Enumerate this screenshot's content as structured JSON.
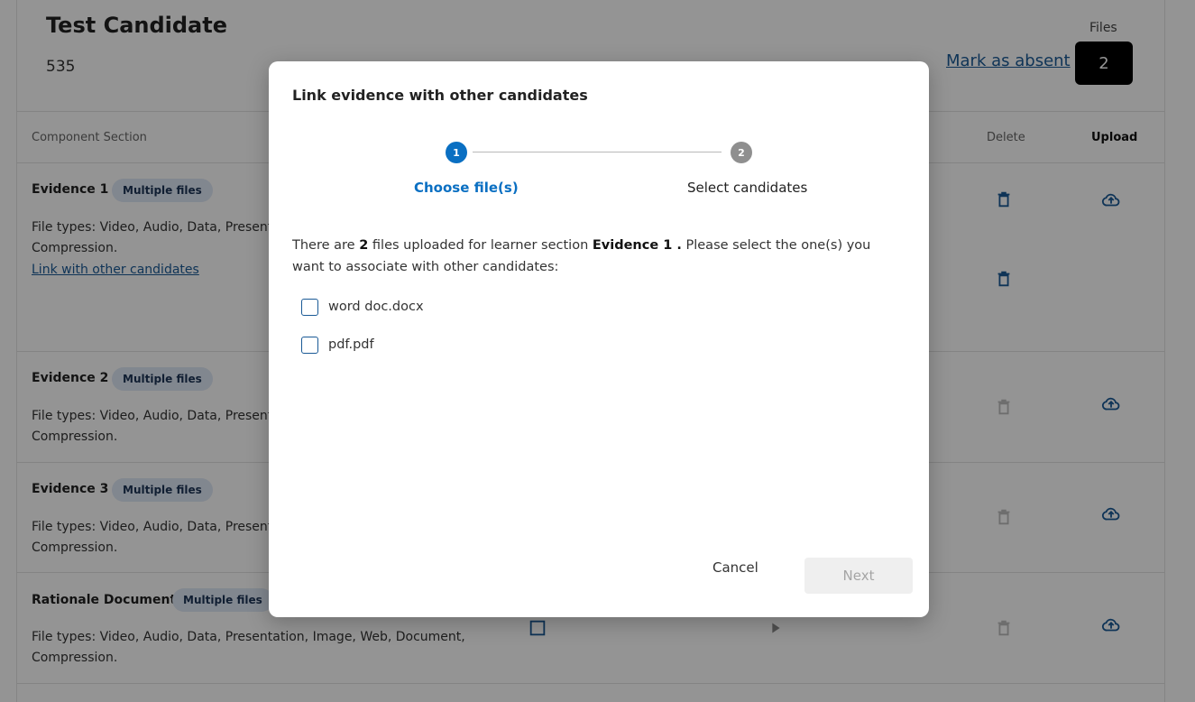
{
  "candidate": {
    "name": "Test Candidate",
    "number": "535",
    "mark_absent": "Mark as absent",
    "files_label": "Files",
    "files_count": "2"
  },
  "table": {
    "headers": {
      "section": "Component Section",
      "delete": "Delete",
      "upload": "Upload"
    },
    "rows": [
      {
        "title": "Evidence 1",
        "badge": "Multiple files",
        "filetypes_line1": "File types: Video, Audio, Data, Presenta",
        "filetypes_line2": "Compression.",
        "link": "Link with other candidates"
      },
      {
        "title": "Evidence 2",
        "badge": "Multiple files",
        "filetypes_line1": "File types: Video, Audio, Data, Presenta",
        "filetypes_line2": "Compression."
      },
      {
        "title": "Evidence 3",
        "badge": "Multiple files",
        "filetypes_line1": "File types: Video, Audio, Data, Presenta",
        "filetypes_line2": "Compression."
      },
      {
        "title": "Rationale Document",
        "badge": "Multiple files",
        "filetypes_line1": "File types: Video, Audio, Data, Presentation, Image, Web, Document,",
        "filetypes_line2": "Compression."
      }
    ]
  },
  "modal": {
    "title": "Link evidence with other candidates",
    "steps": [
      {
        "number": "1",
        "label": "Choose file(s)"
      },
      {
        "number": "2",
        "label": "Select candidates"
      }
    ],
    "description": {
      "pre": "There are ",
      "count": "2",
      "mid": " files uploaded for learner section ",
      "section": "Evidence 1 .",
      "post": " Please select the one(s) you want to associate with other candidates:"
    },
    "files": [
      "word doc.docx",
      "pdf.pdf"
    ],
    "cancel_label": "Cancel",
    "next_label": "Next"
  },
  "colors": {
    "accent": "#0a6fc2",
    "link": "#1a5a96",
    "badge_bg": "#dfe8f6",
    "overlay": "rgba(0,0,0,0.42)"
  },
  "icons": [
    "trash-icon",
    "cloud-upload-icon",
    "checkbox-icon",
    "play-icon"
  ]
}
